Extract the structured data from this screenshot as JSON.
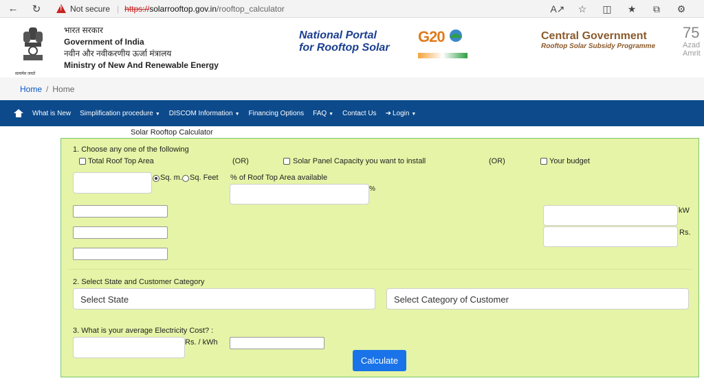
{
  "browser": {
    "security_label": "Not secure",
    "url_scheme": "https://",
    "url_host": "solarrooftop.gov.in",
    "url_path": "/rooftop_calculator"
  },
  "header": {
    "gov_hindi": "भारत सरकार",
    "gov_english": "Government of India",
    "ministry_hindi": "नवीन और नवीकरणीय ऊर्जा मंत्रालय",
    "ministry_english": "Ministry of New And Renewable Energy",
    "emblem_caption": "सत्यमेव जयते",
    "portal_line1": "National Portal",
    "portal_line2": "for Rooftop Solar",
    "g20_text": "G20",
    "central_title": "Central Government",
    "central_subtitle": "Rooftop Solar Subsidy Programme",
    "azadi_number": "75",
    "azadi_line1": "Azad",
    "azadi_line2": "Amrit"
  },
  "breadcrumb": {
    "home": "Home",
    "current": "Home"
  },
  "nav": {
    "items": [
      "What is New",
      "Simplification procedure",
      "DISCOM Information",
      "Financing Options",
      "FAQ",
      "Contact Us",
      "Login"
    ]
  },
  "calculator": {
    "title": "Solar Rooftop Calculator",
    "step1": "1. Choose any one of the following",
    "opt_area": "Total Roof Top Area",
    "or1": "(OR)",
    "opt_capacity": "Solar Panel Capacity you want to install",
    "or2": "(OR)",
    "opt_budget": "Your budget",
    "unit_sqm": "Sq. m.",
    "unit_sqft": "Sq. Feet",
    "pct_label": "% of Roof Top Area available",
    "pct_sign": "%",
    "kw_unit": "kW",
    "rs_unit": "Rs.",
    "step2": "2. Select State and Customer Category",
    "select_state": "Select State",
    "select_category": "Select Category of Customer",
    "step3": "3. What is your average Electricity Cost? :",
    "rs_per_kwh": "Rs. / kWh",
    "calculate": "Calculate"
  }
}
